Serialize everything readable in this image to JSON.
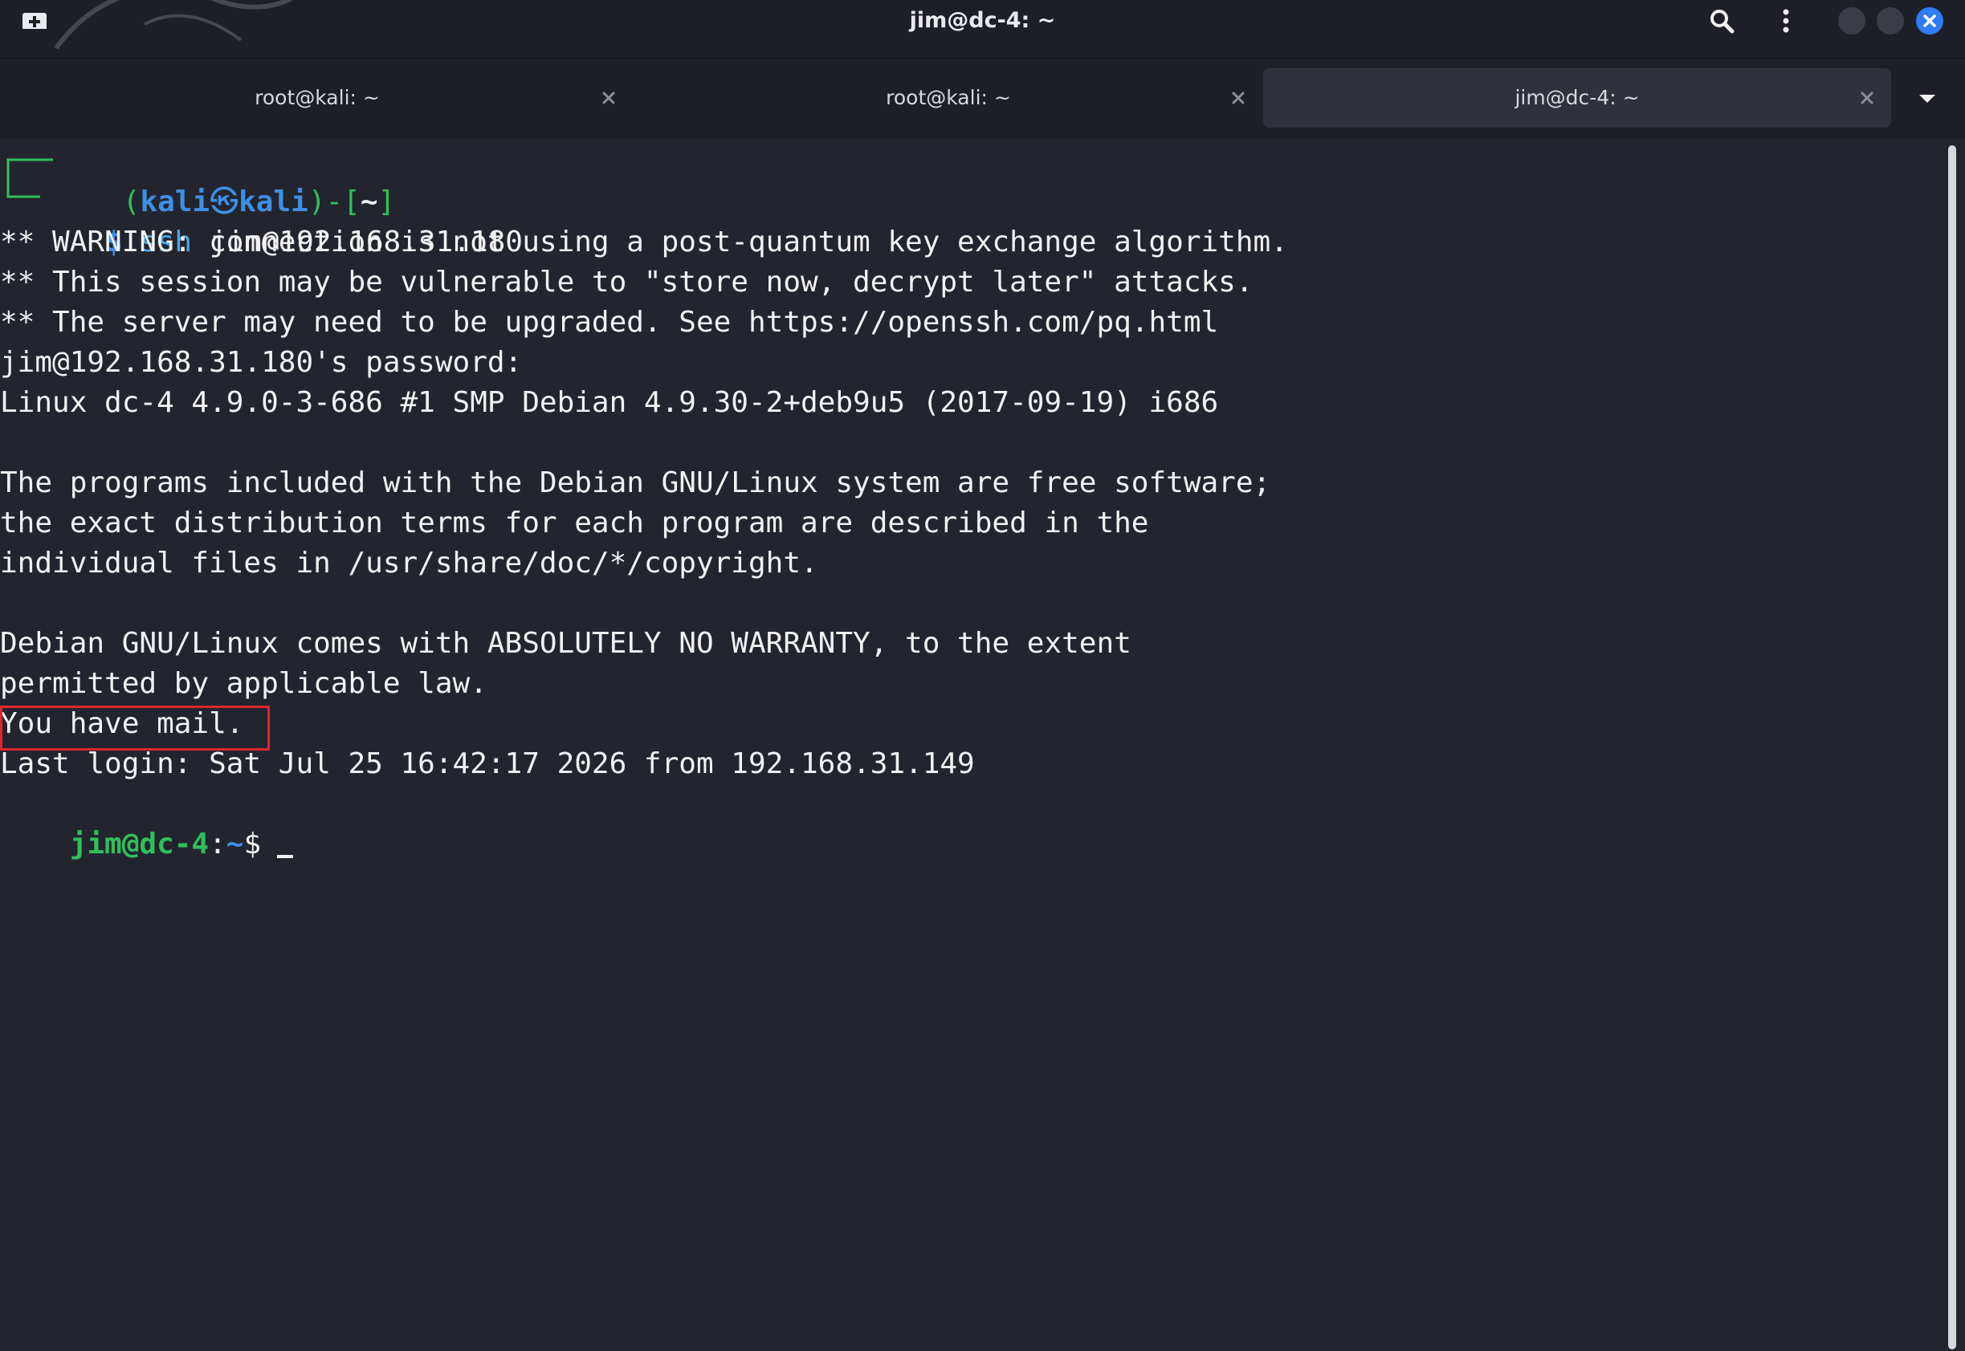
{
  "window": {
    "title": "jim@dc-4: ~"
  },
  "tabs": [
    {
      "label": "root@kali: ~",
      "active": false
    },
    {
      "label": "root@kali: ~",
      "active": false
    },
    {
      "label": "jim@dc-4: ~",
      "active": true
    }
  ],
  "icons": {
    "new_tab": "new-tab-icon",
    "search": "search-icon",
    "menu": "kebab-menu-icon",
    "minimize": "minimize-icon",
    "maximize": "maximize-icon",
    "close": "close-icon",
    "tab_close": "close-icon",
    "tab_dropdown": "chevron-down-icon"
  },
  "colors": {
    "background": "#23252e",
    "prompt_green": "#30c05b",
    "prompt_blue": "#3e8fe6",
    "highlight_red": "#e1262b",
    "close_button": "#2f7cf6"
  },
  "terminal": {
    "kali_prompt": {
      "open_paren": "(",
      "user": "kali",
      "at_symbol": "㉿",
      "host": "kali",
      "close_paren": ")-[",
      "path": "~",
      "close_bracket": "]",
      "dollar": "$",
      "command": "ssh",
      "args": "jim@192.168.31.180"
    },
    "output_lines": [
      "** WARNING: connection is not using a post-quantum key exchange algorithm.",
      "** This session may be vulnerable to \"store now, decrypt later\" attacks.",
      "** The server may need to be upgraded. See https://openssh.com/pq.html",
      "jim@192.168.31.180's password:",
      "Linux dc-4 4.9.0-3-686 #1 SMP Debian 4.9.30-2+deb9u5 (2017-09-19) i686",
      "",
      "The programs included with the Debian GNU/Linux system are free software;",
      "the exact distribution terms for each program are described in the",
      "individual files in /usr/share/doc/*/copyright.",
      "",
      "Debian GNU/Linux comes with ABSOLUTELY NO WARRANTY, to the extent",
      "permitted by applicable law.",
      "You have mail.",
      "Last login: Sat Jul 25 16:42:17 2026 from 192.168.31.149"
    ],
    "remote_prompt": {
      "user_host": "jim@dc-4",
      "colon": ":",
      "path": "~",
      "dollar": "$"
    }
  }
}
